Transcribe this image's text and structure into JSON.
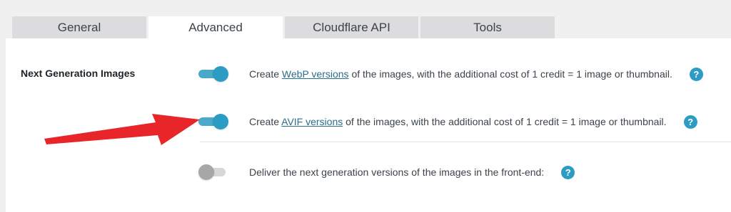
{
  "tabs": [
    {
      "label": "General",
      "active": false
    },
    {
      "label": "Advanced",
      "active": true
    },
    {
      "label": "Cloudflare API",
      "active": false
    },
    {
      "label": "Tools",
      "active": false
    }
  ],
  "section": {
    "label": "Next Generation Images"
  },
  "options": [
    {
      "enabled": true,
      "prefix": "Create ",
      "link": "WebP versions",
      "suffix": " of the images, with the additional cost of 1 credit = 1 image or thumbnail.",
      "help": "?"
    },
    {
      "enabled": true,
      "prefix": "Create ",
      "link": "AVIF versions",
      "suffix": " of the images, with the additional cost of 1 credit = 1 image or thumbnail.",
      "help": "?"
    },
    {
      "enabled": false,
      "text": "Deliver the next generation versions of the images in the front-end:",
      "help": "?"
    }
  ],
  "colors": {
    "accent": "#2c9cc4",
    "arrow": "#e8262a"
  }
}
